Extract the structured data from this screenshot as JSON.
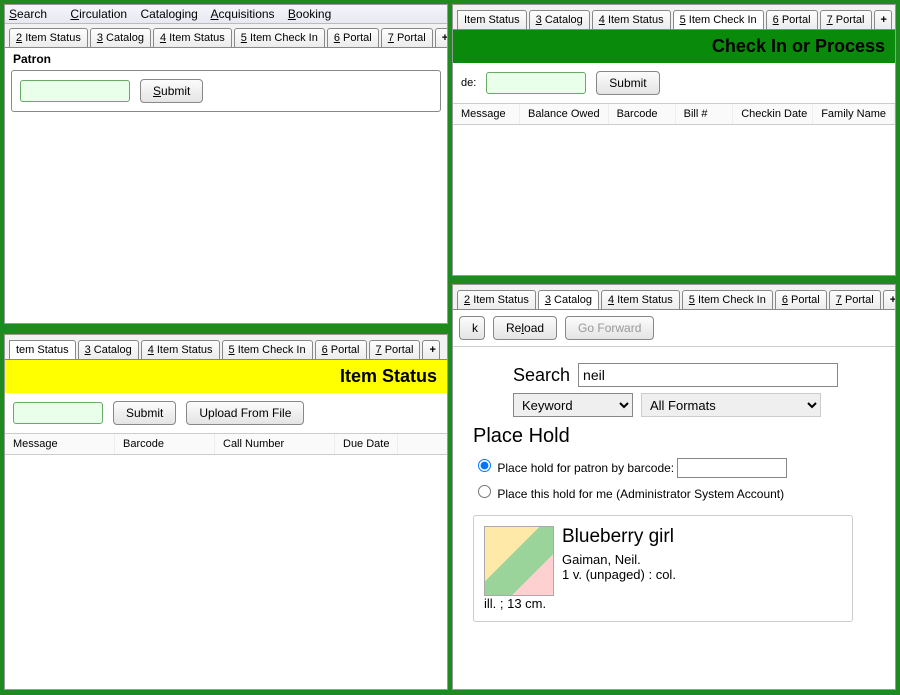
{
  "menu": [
    "Search",
    "Circulation",
    "Cataloging",
    "Acquisitions",
    "Booking"
  ],
  "tabs_full": [
    {
      "n": "2",
      "t": "Item Status"
    },
    {
      "n": "3",
      "t": "Catalog"
    },
    {
      "n": "4",
      "t": "Item Status"
    },
    {
      "n": "5",
      "t": "Item Check In"
    },
    {
      "n": "6",
      "t": "Portal"
    },
    {
      "n": "7",
      "t": "Portal"
    }
  ],
  "plus": "+",
  "patron": {
    "legend": "Patron",
    "submit": "Submit"
  },
  "checkin": {
    "title": "Check In or Process",
    "label": "de:",
    "submit": "Submit",
    "cols": [
      "Message",
      "Balance Owed",
      "Barcode",
      "Bill #",
      "Checkin Date",
      "Family Name"
    ]
  },
  "itemstatus": {
    "title": "Item Status",
    "submit": "Submit",
    "upload": "Upload From File",
    "cols": [
      "Message",
      "Barcode",
      "Call Number",
      "Due Date"
    ]
  },
  "catalog": {
    "back": "k",
    "reload": "Reload",
    "forward": "Go Forward",
    "search_label": "Search",
    "search_value": "neil",
    "field": "Keyword",
    "format": "All Formats",
    "hold_title": "Place Hold",
    "opt1": "Place hold for patron by barcode:",
    "opt2": "Place this hold for me (Administrator System Account)",
    "result": {
      "title": "Blueberry girl",
      "author": "Gaiman, Neil.",
      "desc1": "1 v. (unpaged) : col.",
      "desc2": "ill. ; 13 cm."
    }
  }
}
